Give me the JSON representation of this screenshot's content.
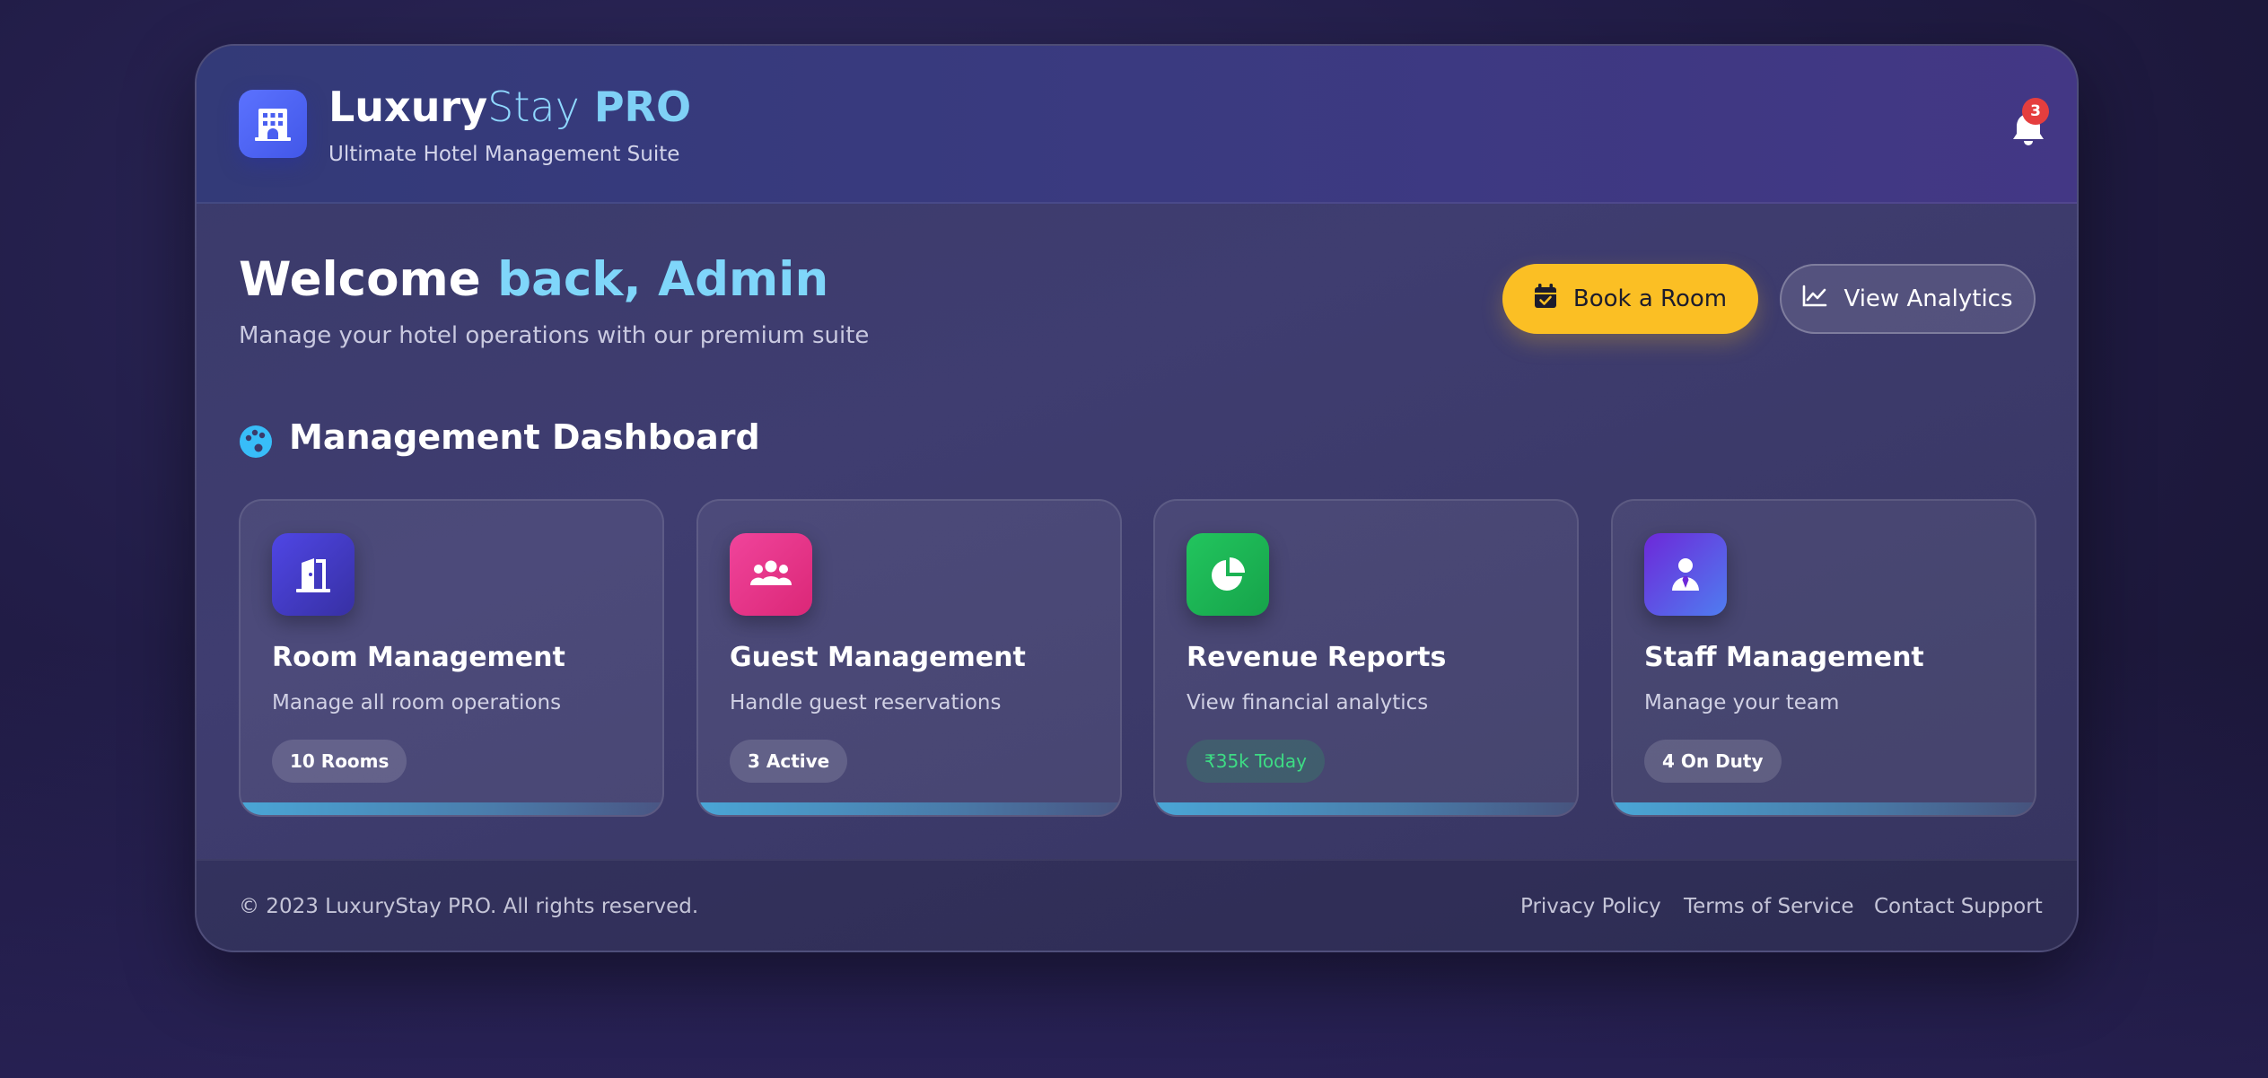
{
  "header": {
    "brand_part1": "Luxury",
    "brand_part2": "Stay",
    "brand_part3": " PRO",
    "tagline": "Ultimate Hotel Management Suite",
    "notification_count": "3"
  },
  "welcome": {
    "title_part1": "Welcome ",
    "title_part2": "back, Admin",
    "subtitle": "Manage your hotel operations with our premium suite"
  },
  "actions": {
    "book_label": "Book a Room",
    "analytics_label": "View Analytics"
  },
  "dashboard": {
    "title": "Management Dashboard",
    "cards": [
      {
        "title": "Room Management",
        "description": "Manage all room operations",
        "stat": "10 Rooms",
        "icon": "door-open-icon"
      },
      {
        "title": "Guest Management",
        "description": "Handle guest reservations",
        "stat": "3 Active",
        "icon": "users-icon"
      },
      {
        "title": "Revenue Reports",
        "description": "View financial analytics",
        "stat": "₹35k Today",
        "icon": "pie-chart-icon"
      },
      {
        "title": "Staff Management",
        "description": "Manage your team",
        "stat": "4 On Duty",
        "icon": "user-tie-icon"
      }
    ]
  },
  "footer": {
    "copyright": "© 2023 LuxuryStay PRO. All rights reserved.",
    "links": [
      "Privacy Policy",
      "Terms of Service",
      "Contact Support"
    ]
  },
  "colors": {
    "accent_cyan": "#7fd6fa",
    "book_button": "#fbbf24",
    "badge_red": "#e53e3e",
    "room_tile": "#4338ca",
    "guest_tile": "#ec4899",
    "revenue_tile": "#22c55e",
    "staff_tile": "#7c3aed",
    "revenue_text": "#3ddc84"
  }
}
